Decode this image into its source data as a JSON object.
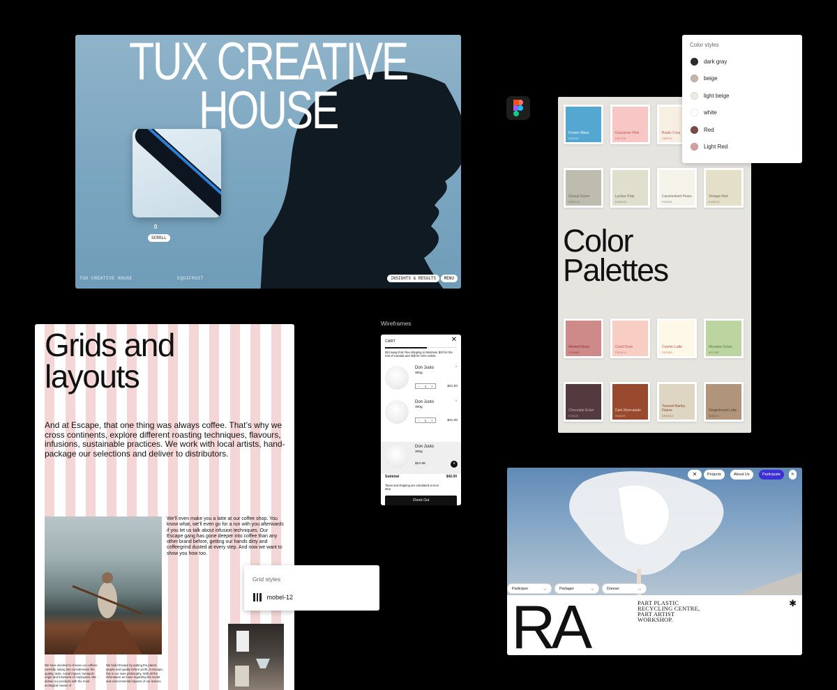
{
  "tux": {
    "title_line1": "TUX CREATIVE",
    "title_line2": "HOUSE",
    "scroll": "SCROLL",
    "footer_left": "TUX CREATIVE HOUSE",
    "footer_mid": "EQUIFRUIT",
    "insights": "INSIGHTS & RESULTS",
    "menu": "MENU"
  },
  "palettes": {
    "title_line1": "Color",
    "title_line2": "Palettes",
    "swatches": [
      {
        "name": "Frozen Wave",
        "hex": "53A7D0",
        "color": "#53a7d0",
        "text": "#fff"
      },
      {
        "name": "Gossamer Pink",
        "hex": "F8C7C5",
        "color": "#f8c7c5",
        "text": "#c0524e"
      },
      {
        "name": "Rustic Crea",
        "hex": "F8EFE3",
        "color": "#f8efe3",
        "text": "#c0524e"
      },
      {
        "name": "Glacial Green",
        "hex": "BDBCAE",
        "color": "#bdbcae",
        "text": "#6b6a5e"
      },
      {
        "name": "Lychee Pulp",
        "hex": "E0DECD",
        "color": "#e0decd",
        "text": "#6b6a5e"
      },
      {
        "name": "Caramelized Pears",
        "hex": "F6F3EA",
        "color": "#f6f3ea",
        "text": "#6b6a5e"
      },
      {
        "name": "Vintage Red",
        "hex": "E4DFC9",
        "color": "#e4dfc9",
        "text": "#6b6a5e"
      },
      {
        "name": "Almond Rose",
        "hex": "CD8A88",
        "color": "#cd8a88",
        "text": "#8b2f2b"
      },
      {
        "name": "Coral Dune",
        "hex": "F8CDC4",
        "color": "#f8cdc4",
        "text": "#c0524e"
      },
      {
        "name": "Cosmic Latte",
        "hex": "FEF8E8",
        "color": "#fef8e8",
        "text": "#c0524e"
      },
      {
        "name": "Meadow Grass",
        "hex": "BCD49F",
        "color": "#bcd49f",
        "text": "#5f7d3c"
      },
      {
        "name": "Chocolate Eclair",
        "hex": "533A3E",
        "color": "#533a3e",
        "text": "#c9b2b3"
      },
      {
        "name": "Dark Marmalade",
        "hex": "994A2E",
        "color": "#994a2e",
        "text": "#f0d0c0"
      },
      {
        "name": "Toasted Barley Flakes",
        "hex": "DED5C3",
        "color": "#ded5c3",
        "text": "#8b4a2e"
      },
      {
        "name": "Gingerbread Latte",
        "hex": "B0957A",
        "color": "#b0957a",
        "text": "#5a3e2a"
      }
    ]
  },
  "color_styles": {
    "header": "Color styles",
    "items": [
      {
        "label": "dark gray",
        "color": "#2b2b2b"
      },
      {
        "label": "beige",
        "color": "#c7b3a8"
      },
      {
        "label": "light beige",
        "color": "#efe9e4"
      },
      {
        "label": "white",
        "color": "#ffffff"
      },
      {
        "label": "Red",
        "color": "#7a4a44"
      },
      {
        "label": "Light Red",
        "color": "#d4a09e"
      }
    ]
  },
  "grids": {
    "title_line1": "Grids and",
    "title_line2": "layouts",
    "paragraph": "And at Escape, that one thing was always coffee. That’s why we cross continents, explore different roasting techniques, flavours, infusions, sustainable practices. We work with local artists, hand-package our selections and deliver to distributors.",
    "paragraph2": "We’ll even make you a latte at our coffee shop. You know what, we’ll even go for a run with you afterwards if you let us talk about infusion techniques. Our Escape gang has gone deeper into coffee than any other brand before, getting our hands dirty and coffeegrind dusted at every step. And now we want to show you how too.",
    "small1": "We have decided to choose our coffees carefully, taking into consideration the quality, taste, social impact, transport, origin and treatment of employees. We deliver our products with the most ecological means of",
    "small2": "We build Escape by putting the planet, people and quality before profit. At Escape, this is our main philosophy. With all the information we have regarding the social and environmental impacts of our actions,"
  },
  "grid_styles": {
    "header": "Grid styles",
    "item": "mobel-12"
  },
  "wireframes": {
    "label": "Wireframes",
    "cart_title": "CART",
    "shipping_note": "$10 away from free shipping in Montreal, $20 for the rest of Canada and 30$ for USA orders.",
    "items": [
      {
        "name": "Don Justo",
        "weight": "300g",
        "qty": "1",
        "price": "$21.00"
      },
      {
        "name": "Don Justo",
        "weight": "300g",
        "qty": "1",
        "price": "$21.00"
      }
    ],
    "upsell": {
      "name": "Don Justo",
      "weight": "300g",
      "price": "$24.99"
    },
    "subtotal_label": "Subtotal",
    "subtotal_value": "$42.00",
    "tax_note": "Taxes and shipping are calculated at next step",
    "checkout": "Check Out"
  },
  "ra": {
    "nav": [
      "Projects",
      "About Us",
      "Participate",
      "fr"
    ],
    "tags": [
      "Participer",
      "Partager",
      "Donner"
    ],
    "logo": "RA",
    "desc_line1": "PART PLASTIC",
    "desc_line2": "RECYCLING CENTRE,",
    "desc_line3": "PART ARTIST",
    "desc_line4": "WORKSHOP."
  }
}
